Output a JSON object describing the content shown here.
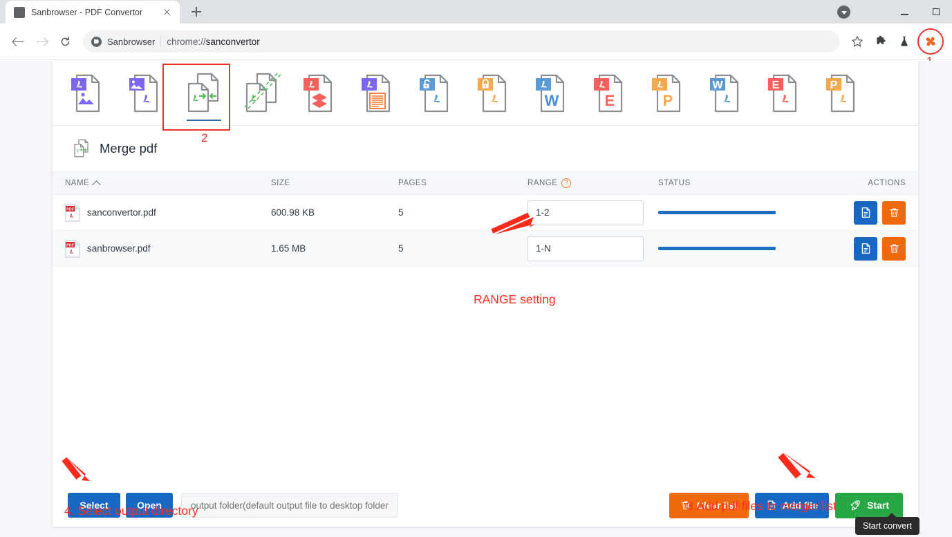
{
  "browser": {
    "tab": {
      "title": "Sanbrowser - PDF Convertor",
      "favicon": "page-icon"
    },
    "newtab_label": "+",
    "url": {
      "site_name": "Sanbrowser",
      "address": "chrome://sanconvertor",
      "scheme_prefix": "chrome://",
      "path": "sanconvertor"
    },
    "omnibox_icons": [
      "star-icon",
      "puzzle-icon",
      "flask-icon",
      "pinwheel-extension-icon"
    ],
    "window_controls": [
      "minimize",
      "maximize"
    ],
    "annotation_1": "1"
  },
  "toolbar": {
    "items": [
      {
        "name": "pdf-to-image",
        "badge": "pdf",
        "badge_color": "#7b68ee",
        "body": "image",
        "body_color": "#7b68ee",
        "active": false
      },
      {
        "name": "image-to-pdf",
        "badge": "image",
        "badge_color": "#7b68ee",
        "body": "pdf",
        "body_color": "#7b68ee",
        "active": false
      },
      {
        "name": "merge-pdf",
        "badge": "none",
        "badge_color": "",
        "body": "merge",
        "body_color": "#4caf50",
        "active": true
      },
      {
        "name": "split-pdf",
        "badge": "none",
        "badge_color": "",
        "body": "split",
        "body_color": "#4caf50",
        "active": false
      },
      {
        "name": "compress-pdf",
        "badge": "pdf",
        "badge_color": "#f4615d",
        "body": "layers",
        "body_color": "#f4615d",
        "active": false
      },
      {
        "name": "pdf-to-text",
        "badge": "pdf",
        "badge_color": "#7b68ee",
        "body": "lines",
        "body_color": "#f4752b",
        "active": false
      },
      {
        "name": "unlock-pdf",
        "badge": "unlock",
        "badge_color": "#5b9bd5",
        "body": "pdf",
        "body_color": "#5b9bd5",
        "active": false
      },
      {
        "name": "lock-pdf",
        "badge": "lock",
        "badge_color": "#f5a94e",
        "body": "pdf",
        "body_color": "#f5a94e",
        "active": false
      },
      {
        "name": "pdf-to-word",
        "badge": "pdf",
        "badge_color": "#5b9bd5",
        "body": "W",
        "body_color": "#4a8fd4",
        "active": false
      },
      {
        "name": "pdf-to-excel",
        "badge": "pdf",
        "badge_color": "#f4615d",
        "body": "E",
        "body_color": "#f4615d",
        "active": false
      },
      {
        "name": "pdf-to-ppt",
        "badge": "pdf",
        "badge_color": "#f5a94e",
        "body": "P",
        "body_color": "#f5a94e",
        "active": false
      },
      {
        "name": "word-to-pdf",
        "badge": "W",
        "badge_color": "#5b9bd5",
        "body": "pdf",
        "body_color": "#5b9bd5",
        "active": false
      },
      {
        "name": "excel-to-pdf",
        "badge": "E",
        "badge_color": "#f4615d",
        "body": "pdf",
        "body_color": "#f4615d",
        "active": false
      },
      {
        "name": "ppt-to-pdf",
        "badge": "P",
        "badge_color": "#f5a94e",
        "body": "pdf",
        "body_color": "#f5a94e",
        "active": false
      }
    ],
    "annotation_2": "2"
  },
  "panel": {
    "title": "Merge pdf",
    "title_icon": "merge-pdf-icon"
  },
  "table": {
    "columns": [
      "NAME",
      "SIZE",
      "PAGES",
      "RANGE",
      "STATUS",
      "ACTIONS"
    ],
    "sort_column": "NAME",
    "sort_direction": "asc",
    "range_help_icon": "question-mark-icon",
    "rows": [
      {
        "name": "sanconvertor.pdf",
        "size": "600.98 KB",
        "pages": "5",
        "range": "1-2",
        "status_progress": 100,
        "icon": "pdf-file-icon",
        "preview_label": "preview",
        "delete_label": "delete"
      },
      {
        "name": "sanbrowser.pdf",
        "size": "1.65 MB",
        "pages": "5",
        "range": "1-N",
        "status_progress": 100,
        "icon": "pdf-file-icon",
        "preview_label": "preview",
        "delete_label": "delete"
      }
    ]
  },
  "bottom": {
    "select_label": "Select",
    "open_label": "Open",
    "output_placeholder": "output folder(default output file to desktop folder)",
    "output_value": "",
    "clear_label": "Clear list",
    "add_label": "Add file",
    "start_label": "Start",
    "tooltip": "Start convert"
  },
  "annotations": {
    "range_setting": "RANGE setting",
    "output_directory": "4. Select output directory",
    "add_files": "3.Add pdf files to merger list"
  },
  "colors": {
    "annotation_red": "#ff2d20",
    "primary_blue": "#1668c2",
    "orange": "#f0690d",
    "green": "#28a745",
    "progress_blue": "#1b6ec2"
  }
}
